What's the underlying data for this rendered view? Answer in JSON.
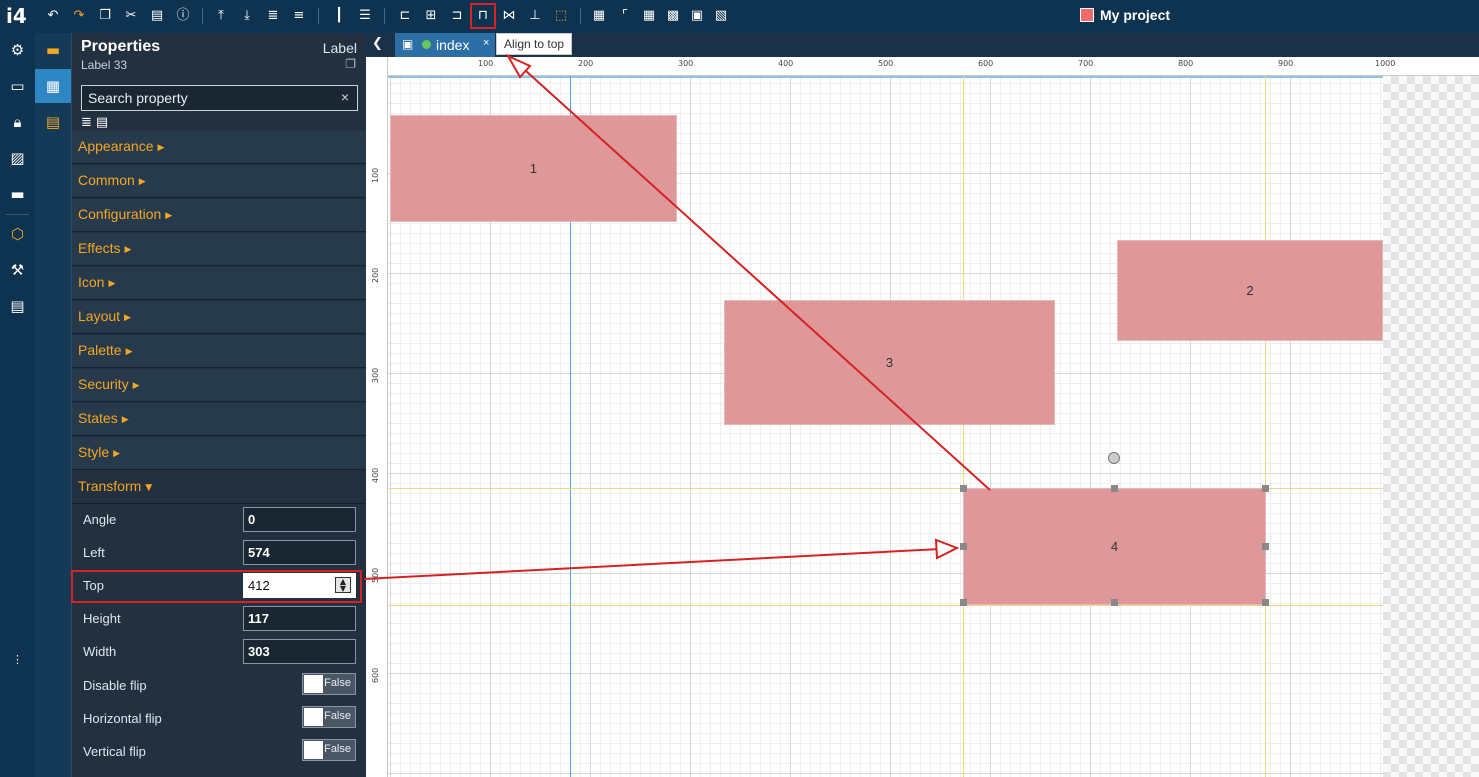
{
  "app": {
    "logo": "i4",
    "project_title": "My project"
  },
  "toolbar": {
    "icons": [
      "undo-icon",
      "redo-icon",
      "copy-icon",
      "cut-icon",
      "paste-icon",
      "info-icon",
      "bring-forward-icon",
      "send-backward-icon",
      "bring-to-front-icon",
      "send-to-back-icon",
      "distribute-horizontal-icon",
      "distribute-vertical-icon",
      "align-left-icon",
      "align-center-icon",
      "align-right-icon",
      "align-top-icon",
      "align-middle-icon",
      "align-bottom-icon",
      "select-frame-icon",
      "grid-icon",
      "ruler-icon",
      "table-icon",
      "table-alt-icon",
      "pattern-icon",
      "image-icon"
    ],
    "selected": "align-top-icon"
  },
  "tooltip": "Align to top",
  "tab": {
    "name": "index",
    "close": "×"
  },
  "properties": {
    "title": "Properties",
    "type": "Label",
    "subtitle": "Label 33",
    "search_placeholder": "Search property",
    "search_clear": "×",
    "categories": [
      {
        "label": "Appearance"
      },
      {
        "label": "Common"
      },
      {
        "label": "Configuration"
      },
      {
        "label": "Effects"
      },
      {
        "label": "Icon"
      },
      {
        "label": "Layout"
      },
      {
        "label": "Palette"
      },
      {
        "label": "Security"
      },
      {
        "label": "States"
      },
      {
        "label": "Style"
      },
      {
        "label": "Transform"
      }
    ],
    "transform": [
      {
        "label": "Angle",
        "value": "0"
      },
      {
        "label": "Left",
        "value": "574"
      },
      {
        "label": "Top",
        "value": "412"
      },
      {
        "label": "Height",
        "value": "117"
      },
      {
        "label": "Width",
        "value": "303"
      }
    ],
    "flips": [
      {
        "label": "Disable flip",
        "value": "False"
      },
      {
        "label": "Horizontal flip",
        "value": "False"
      },
      {
        "label": "Vertical flip",
        "value": "False"
      }
    ]
  },
  "rulers": {
    "h": [
      "100",
      "200",
      "300",
      "400",
      "500",
      "600",
      "700",
      "800",
      "900",
      "1000"
    ],
    "v": [
      "100",
      "200",
      "300",
      "400",
      "500",
      "600"
    ]
  },
  "canvas": {
    "labels": [
      {
        "text": "1"
      },
      {
        "text": "2"
      },
      {
        "text": "3"
      },
      {
        "text": "4"
      }
    ]
  },
  "colors": {
    "accent": "#f5a623",
    "label_fill": "#de9899",
    "highlight": "#d62222"
  }
}
